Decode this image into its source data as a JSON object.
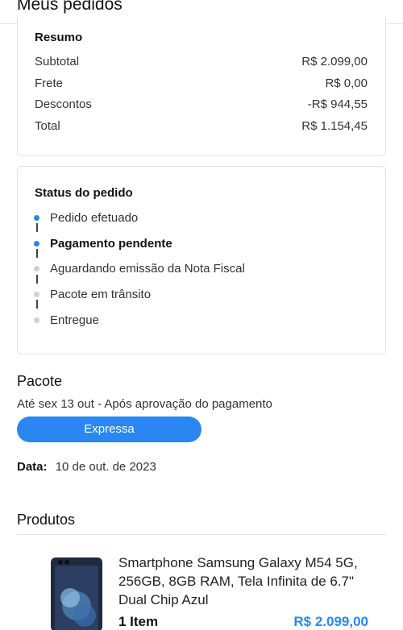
{
  "header": {
    "title": "Meus pedidos"
  },
  "summary": {
    "title": "Resumo",
    "rows": [
      {
        "label": "Subtotal",
        "value": "R$ 2.099,00"
      },
      {
        "label": "Frete",
        "value": "R$ 0,00"
      },
      {
        "label": "Descontos",
        "value": "-R$ 944,55"
      },
      {
        "label": "Total",
        "value": "R$ 1.154,45"
      }
    ]
  },
  "status": {
    "title": "Status do pedido",
    "steps": [
      {
        "label": "Pedido efetuado",
        "state": "done"
      },
      {
        "label": "Pagamento pendente",
        "state": "current"
      },
      {
        "label": "Aguardando emissão da Nota Fiscal",
        "state": "pending"
      },
      {
        "label": "Pacote em trânsito",
        "state": "pending"
      },
      {
        "label": "Entregue",
        "state": "pending"
      }
    ]
  },
  "package": {
    "title": "Pacote",
    "eta": "Até sex 13 out - Após aprovação do pagamento",
    "shipping_badge": "Expressa",
    "date_label": "Data:",
    "date_value": "10 de out. de 2023"
  },
  "products": {
    "title": "Produtos",
    "items": [
      {
        "name": "Smartphone Samsung Galaxy M54 5G, 256GB, 8GB RAM, Tela Infinita de 6.7\" Dual Chip Azul",
        "quantity": "1 Item",
        "price": "R$ 2.099,00",
        "image_icon": "smartphone-icon"
      }
    ]
  },
  "colors": {
    "accent": "#2a86f0",
    "inactive_dot": "#cfcfcf",
    "border": "#e3e3e3"
  }
}
